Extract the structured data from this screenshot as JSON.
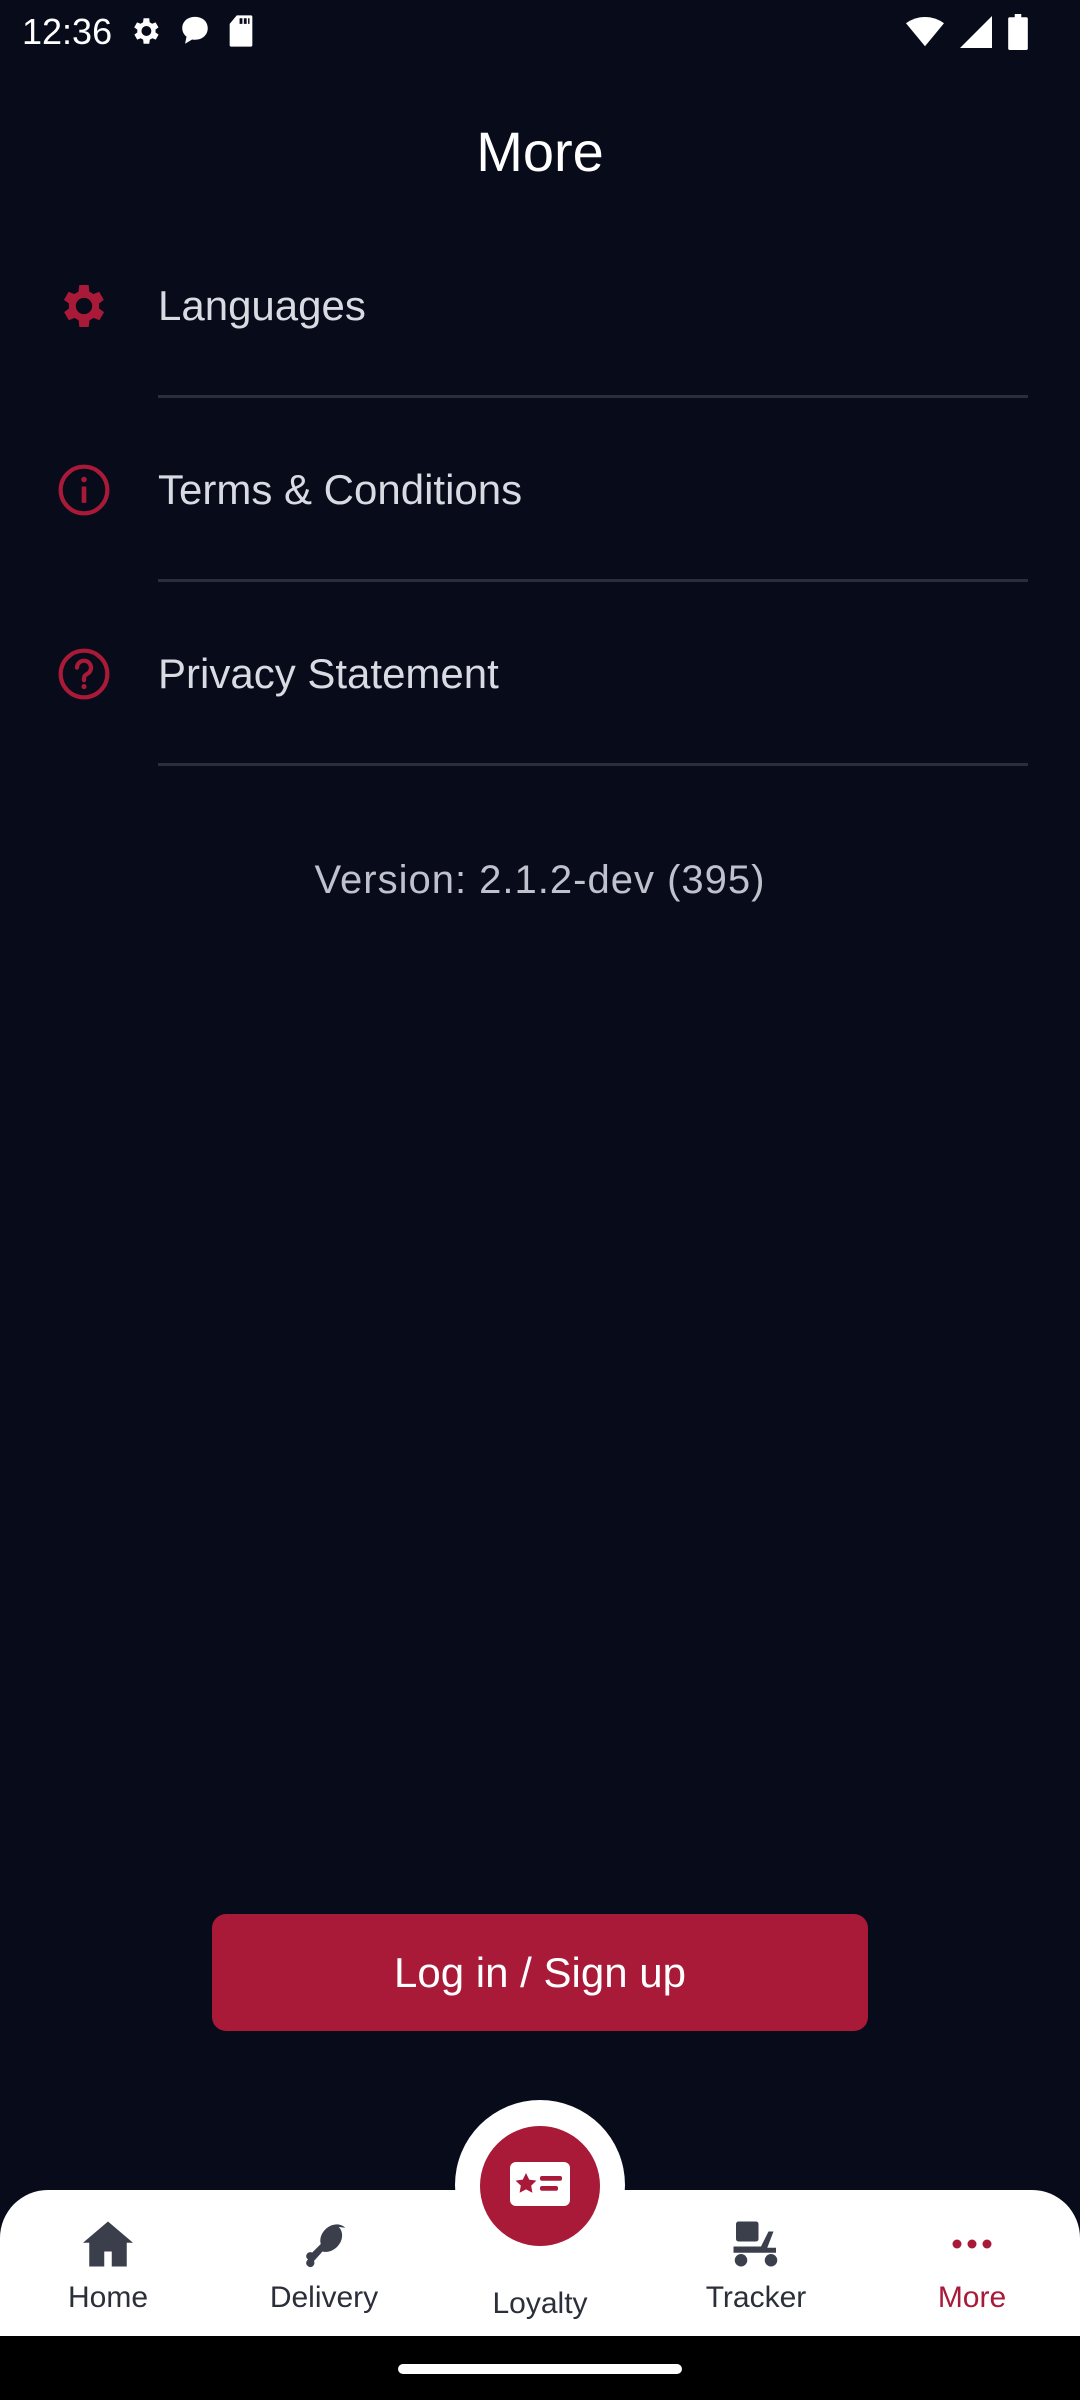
{
  "status_bar": {
    "time": "12:36",
    "left_icons": [
      "gear-icon",
      "chat-bubble-icon",
      "sd-card-icon"
    ],
    "right_icons": [
      "wifi-icon",
      "cell-signal-icon",
      "battery-icon"
    ]
  },
  "page": {
    "title": "More"
  },
  "menu": {
    "items": [
      {
        "label": "Languages",
        "icon": "gear-icon"
      },
      {
        "label": "Terms & Conditions",
        "icon": "info-icon"
      },
      {
        "label": "Privacy Statement",
        "icon": "question-icon"
      }
    ]
  },
  "version": {
    "text": "Version: 2.1.2-dev (395)"
  },
  "login_button": {
    "label": "Log in / Sign up"
  },
  "bottom_nav": {
    "items": [
      {
        "label": "Home",
        "icon": "home-icon"
      },
      {
        "label": "Delivery",
        "icon": "drumstick-icon"
      },
      {
        "label": "Loyalty",
        "icon": "loyalty-card-icon"
      },
      {
        "label": "Tracker",
        "icon": "scooter-icon"
      },
      {
        "label": "More",
        "icon": "more-dots-icon",
        "active": true
      }
    ]
  },
  "colors": {
    "background": "#070b1a",
    "accent": "#a81a38",
    "text_primary": "#ffffff",
    "text_secondary": "#d9dbe2",
    "divider": "#2a2e3c",
    "nav_background": "#ffffff",
    "nav_text": "#2b2f3a"
  }
}
